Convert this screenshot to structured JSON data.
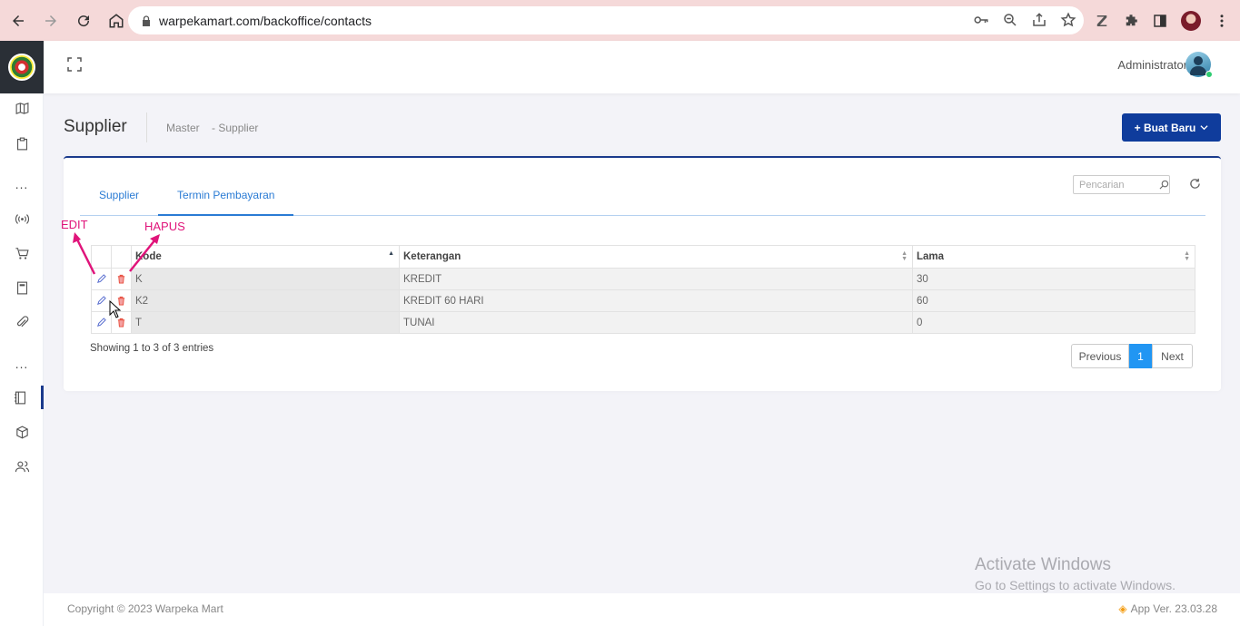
{
  "browser": {
    "url": "warpekamart.com/backoffice/contacts"
  },
  "header": {
    "user_name": "Administrator"
  },
  "page": {
    "title": "Supplier",
    "breadcrumb": [
      "Master",
      "- Supplier"
    ],
    "create_button": "+ Buat Baru"
  },
  "tabs": [
    {
      "label": "Supplier",
      "active": false
    },
    {
      "label": "Termin Pembayaran",
      "active": true
    }
  ],
  "search": {
    "placeholder": "Pencarian"
  },
  "table": {
    "columns": [
      "Kode",
      "Keterangan",
      "Lama"
    ],
    "rows": [
      {
        "kode": "K",
        "keterangan": "KREDIT",
        "lama": "30"
      },
      {
        "kode": "K2",
        "keterangan": "KREDIT 60 HARI",
        "lama": "60"
      },
      {
        "kode": "T",
        "keterangan": "TUNAI",
        "lama": "0"
      }
    ]
  },
  "pagination": {
    "info": "Showing 1 to 3 of 3 entries",
    "previous": "Previous",
    "current": "1",
    "next": "Next"
  },
  "annotations": {
    "edit": "EDIT",
    "delete": "HAPUS"
  },
  "watermark": {
    "title": "Activate Windows",
    "subtitle": "Go to Settings to activate Windows."
  },
  "footer": {
    "copyright": "Copyright © 2023 Warpeka Mart",
    "version": "App Ver. 23.03.28"
  },
  "colors": {
    "primary": "#0f3c9c",
    "link": "#2a7bd4",
    "annotation": "#e0147a",
    "pagination_active": "#2196f3"
  }
}
